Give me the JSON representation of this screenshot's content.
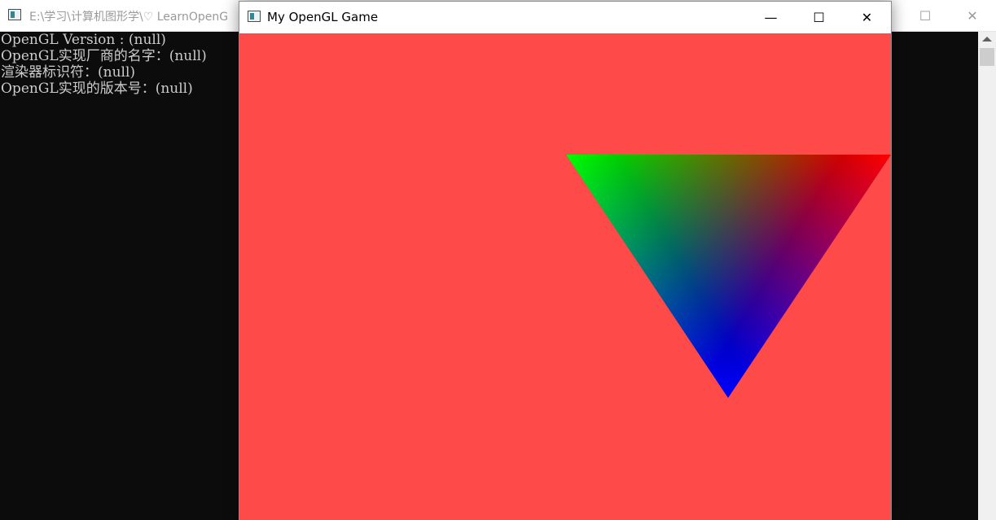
{
  "console": {
    "title": "E:\\学习\\计算机图形学\\♡ LearnOpenG",
    "controls": {
      "minimize": "—",
      "maximize": "☐",
      "close": "✕"
    },
    "lines": [
      "OpenGL Version : (null)",
      "OpenGL实现厂商的名字：(null)",
      "渲染器标识符：(null)",
      "OpenGL实现的版本号：(null)"
    ],
    "background": "#0c0c0c",
    "text_color": "#cccccc"
  },
  "gl_window": {
    "title": "My OpenGL Game",
    "controls": {
      "minimize": "—",
      "maximize": "☐",
      "close": "✕"
    },
    "clear_color": "#ff4a4a",
    "triangle_vertex_colors": {
      "top_left": "#00ff00",
      "top_right": "#ff0000",
      "bottom": "#0000ff"
    }
  }
}
